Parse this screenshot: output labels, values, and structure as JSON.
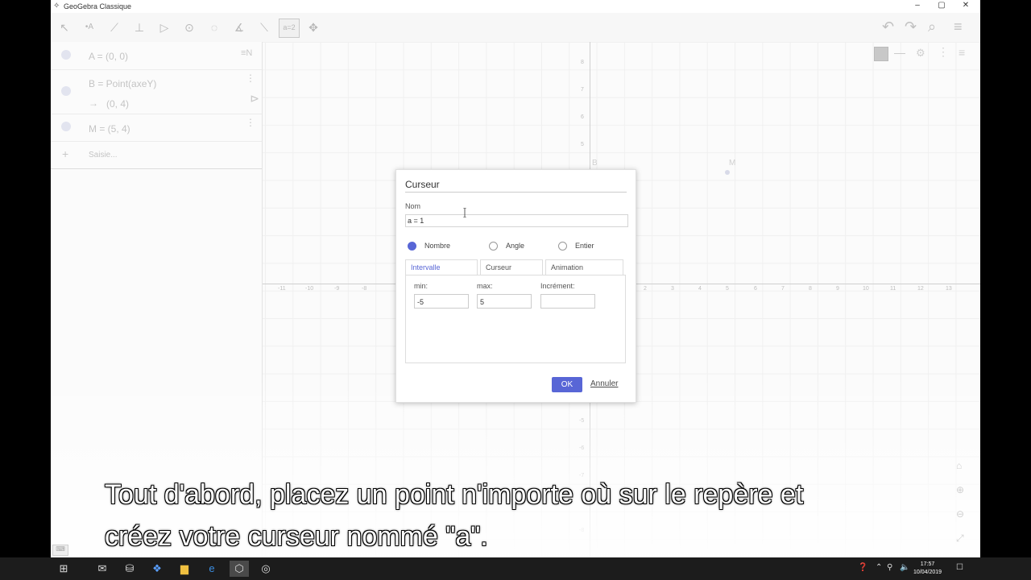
{
  "window": {
    "title": "GeoGebra Classique",
    "controls": {
      "minimize": "–",
      "maximize": "▢",
      "close": "✕"
    }
  },
  "toolbar": {
    "tools": [
      {
        "name": "move-tool",
        "glyph": "↖"
      },
      {
        "name": "point-tool",
        "glyph": "•A"
      },
      {
        "name": "line-tool",
        "glyph": "⟋"
      },
      {
        "name": "perpendicular-tool",
        "glyph": "⊥"
      },
      {
        "name": "polygon-tool",
        "glyph": "▷"
      },
      {
        "name": "circle-tool",
        "glyph": "⊙"
      },
      {
        "name": "conic-tool",
        "glyph": "◌"
      },
      {
        "name": "angle-tool",
        "glyph": "∡"
      },
      {
        "name": "reflect-tool",
        "glyph": "⟍"
      },
      {
        "name": "slider-tool",
        "glyph": "a=2"
      },
      {
        "name": "move-view-tool",
        "glyph": "✥"
      }
    ],
    "right": {
      "undo": "↶",
      "redo": "↷",
      "search": "⌕",
      "menu": "≡"
    }
  },
  "algebra": {
    "sort_icon": "≡N",
    "items": [
      {
        "text": "A = (0, 0)"
      },
      {
        "text": "B = Point(axeY)",
        "value": "(0, 4)",
        "arrow": "→"
      },
      {
        "text": "M = (5, 4)"
      }
    ],
    "input_placeholder": "Saisie...",
    "add": "+"
  },
  "graphics": {
    "x_ticks": [
      "-11",
      "-10",
      "-9",
      "-8",
      "2",
      "3",
      "4",
      "5",
      "6",
      "7",
      "8",
      "9",
      "10",
      "11",
      "12",
      "13"
    ],
    "y_ticks": [
      "8",
      "7",
      "6",
      "5",
      "-5",
      "-6",
      "-7",
      "-8"
    ],
    "points": [
      {
        "label": "M"
      },
      {
        "label": "B"
      }
    ]
  },
  "dialog": {
    "title": "Curseur",
    "name_label": "Nom",
    "name_value": "a = 1",
    "types": [
      {
        "label": "Nombre",
        "selected": true
      },
      {
        "label": "Angle",
        "selected": false
      },
      {
        "label": "Entier",
        "selected": false
      }
    ],
    "tabs": [
      {
        "label": "Intervalle",
        "selected": true
      },
      {
        "label": "Curseur",
        "selected": false
      },
      {
        "label": "Animation",
        "selected": false
      }
    ],
    "fields": [
      {
        "label": "min:",
        "value": "-5"
      },
      {
        "label": "max:",
        "value": "5"
      },
      {
        "label": "Incrément:",
        "value": ""
      }
    ],
    "ok": "OK",
    "cancel": "Annuler"
  },
  "subtitle": {
    "line1": "Tout d'abord, placez un point n'importe où sur le repère et",
    "line2": "créez votre curseur nommé \"a\"."
  },
  "taskbar": {
    "time": "17:57",
    "date": "10/04/2019"
  },
  "colors": {
    "accent": "#5866d6"
  }
}
